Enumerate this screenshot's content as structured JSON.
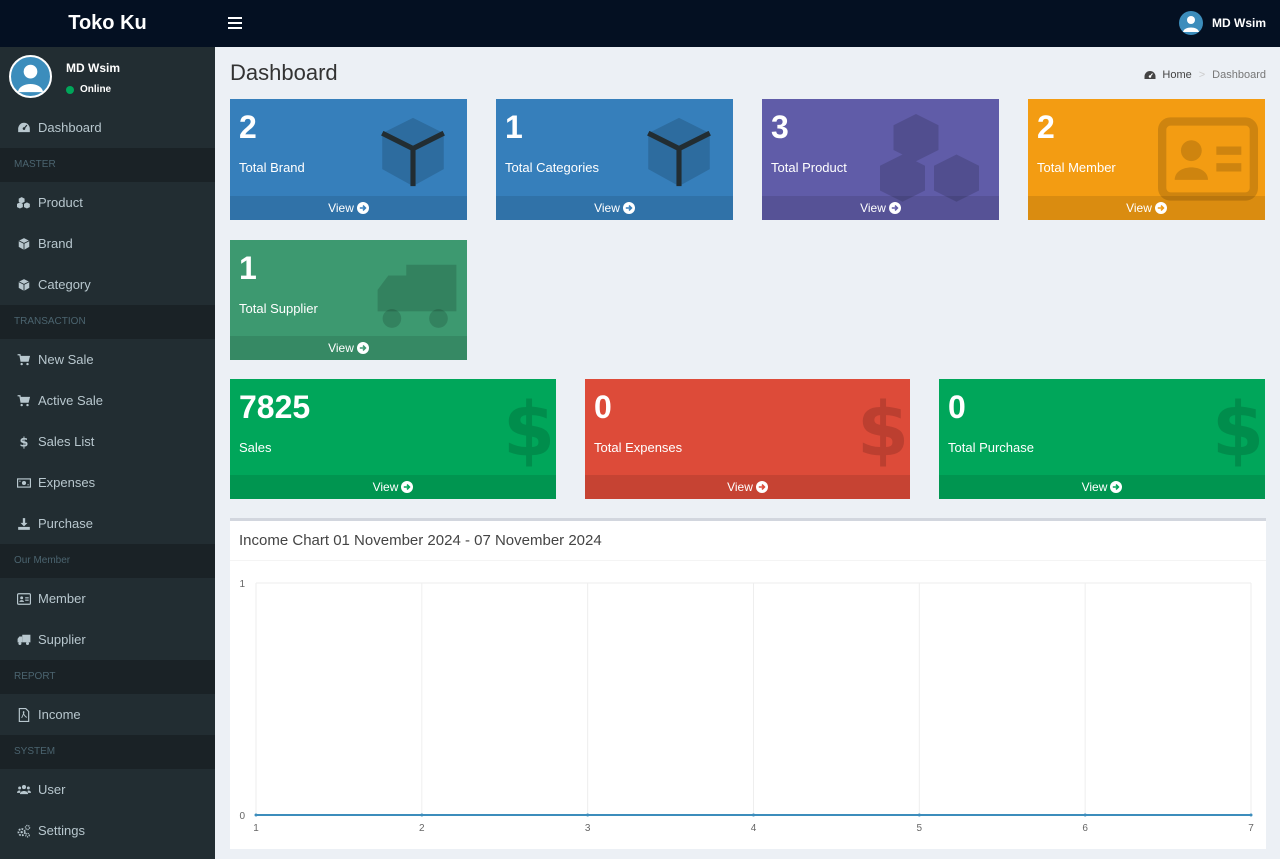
{
  "app": {
    "brand": "Toko Ku"
  },
  "header": {
    "user_name": "MD Wsim"
  },
  "sidebar": {
    "user": {
      "name": "MD Wsim",
      "status": "Online"
    },
    "entries": [
      {
        "kind": "item",
        "label": "Dashboard",
        "icon": "dashboard-icon"
      },
      {
        "kind": "header",
        "label": "MASTER"
      },
      {
        "kind": "item",
        "label": "Product",
        "icon": "cubes-icon"
      },
      {
        "kind": "item",
        "label": "Brand",
        "icon": "cube-icon"
      },
      {
        "kind": "item",
        "label": "Category",
        "icon": "cube-icon"
      },
      {
        "kind": "header",
        "label": "TRANSACTION"
      },
      {
        "kind": "item",
        "label": "New Sale",
        "icon": "cart-icon"
      },
      {
        "kind": "item",
        "label": "Active Sale",
        "icon": "cart-icon"
      },
      {
        "kind": "item",
        "label": "Sales List",
        "icon": "dollar-icon"
      },
      {
        "kind": "item",
        "label": "Expenses",
        "icon": "money-icon"
      },
      {
        "kind": "item",
        "label": "Purchase",
        "icon": "download-icon"
      },
      {
        "kind": "header",
        "label": "Our Member"
      },
      {
        "kind": "item",
        "label": "Member",
        "icon": "id-card-icon"
      },
      {
        "kind": "item",
        "label": "Supplier",
        "icon": "truck-icon"
      },
      {
        "kind": "header",
        "label": "REPORT"
      },
      {
        "kind": "item",
        "label": "Income",
        "icon": "pdf-file-icon"
      },
      {
        "kind": "header",
        "label": "SYSTEM"
      },
      {
        "kind": "item",
        "label": "User",
        "icon": "users-icon"
      },
      {
        "kind": "item",
        "label": "Settings",
        "icon": "cogs-icon"
      }
    ]
  },
  "page": {
    "title": "Dashboard",
    "breadcrumb": {
      "home": "Home",
      "current": "Dashboard"
    }
  },
  "boxes": [
    {
      "value": "2",
      "label": "Total Brand",
      "link": "View",
      "color": "#367fbb",
      "icon": "cube-icon"
    },
    {
      "value": "1",
      "label": "Total Categories",
      "link": "View",
      "color": "#367fbb",
      "icon": "cube-icon"
    },
    {
      "value": "3",
      "label": "Total Product",
      "link": "View",
      "color": "#605ca8",
      "icon": "cubes-icon"
    },
    {
      "value": "2",
      "label": "Total Member",
      "link": "View",
      "color": "#f39c12",
      "icon": "id-card-icon"
    },
    {
      "value": "1",
      "label": "Total Supplier",
      "link": "View",
      "color": "#3d9970",
      "icon": "truck-icon"
    },
    {
      "value": "7825",
      "label": "Sales",
      "link": "View",
      "color": "#00a65a",
      "icon": "dollar-icon"
    },
    {
      "value": "0",
      "label": "Total Expenses",
      "link": "View",
      "color": "#dd4b39",
      "icon": "dollar-icon"
    },
    {
      "value": "0",
      "label": "Total Purchase",
      "link": "View",
      "color": "#00a65a",
      "icon": "dollar-icon"
    }
  ],
  "chart": {
    "title": "Income Chart 01 November 2024 - 07 November 2024"
  },
  "chart_data": {
    "type": "line",
    "title": "Income Chart 01 November 2024 - 07 November 2024",
    "x": [
      1,
      2,
      3,
      4,
      5,
      6,
      7
    ],
    "series": [
      {
        "values": [
          0,
          0,
          0,
          0,
          0,
          0,
          0
        ],
        "color": "#3c8dbc"
      }
    ],
    "ylim": [
      0,
      1
    ],
    "yticks": [
      0,
      1
    ],
    "grid": true
  }
}
